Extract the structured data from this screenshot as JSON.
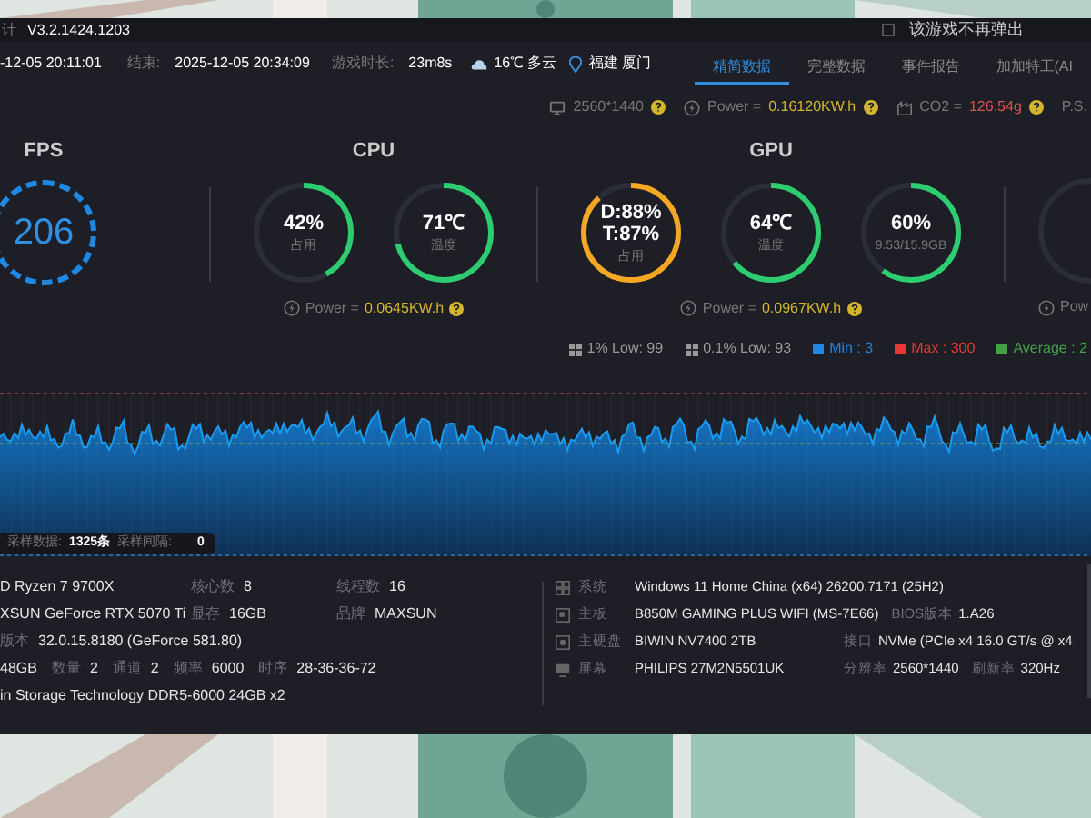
{
  "title_bar": {
    "app_name": "计",
    "version": "V3.2.1424.1203",
    "dont_show_again": {
      "label": "该游戏不再弹出",
      "checked": false
    }
  },
  "session": {
    "start": "-12-05 20:11:01",
    "end_label": "结束:",
    "end": "2025-12-05 20:34:09",
    "duration_label": "游戏时长:",
    "duration": "23m8s",
    "weather": "16℃ 多云",
    "location": "福建 厦门"
  },
  "tabs": [
    {
      "label": "精简数据",
      "selected": true
    },
    {
      "label": "完整数据",
      "selected": false
    },
    {
      "label": "事件报告",
      "selected": false
    },
    {
      "label": "加加特工(AI",
      "selected": false
    }
  ],
  "summary": [
    {
      "kind": "resolution",
      "value": "2560*1440"
    },
    {
      "kind": "power",
      "label": "Power = ",
      "value": "0.16120KW.h"
    },
    {
      "kind": "co2",
      "label": "CO2 = ",
      "value": "126.54g"
    },
    {
      "kind": "note",
      "value": "P.S."
    }
  ],
  "fps": {
    "title": "FPS",
    "value": "206"
  },
  "cpu": {
    "title": "CPU",
    "gauges": [
      {
        "values": [
          "42%"
        ],
        "caption": "占用",
        "level": 0.42,
        "color": "#2ecc71"
      },
      {
        "values": [
          "71℃"
        ],
        "caption": "温度",
        "level": 0.71,
        "color": "#2ecc71"
      }
    ],
    "power_label": "Power = ",
    "power": "0.0645KW.h"
  },
  "gpu": {
    "title": "GPU",
    "gauges": [
      {
        "values": [
          "D:88%",
          "T:87%"
        ],
        "caption": "占用",
        "level": 0.88,
        "color": "#f5a623"
      },
      {
        "values": [
          "64℃"
        ],
        "caption": "温度",
        "level": 0.64,
        "color": "#2ecc71"
      },
      {
        "values": [
          "60%"
        ],
        "caption": "9.53/15.9GB",
        "level": 0.6,
        "color": "#2ecc71"
      }
    ],
    "power_label": "Power = ",
    "power": "0.0967KW.h"
  },
  "next_panel": {
    "power_label": "Pow"
  },
  "fps_stats": [
    {
      "kind": "low",
      "text": "1% Low: 99"
    },
    {
      "kind": "low",
      "text": "0.1% Low: 93"
    },
    {
      "kind": "legend",
      "text": "Min : 3",
      "color": "#1e88e5"
    },
    {
      "kind": "legend",
      "text": "Max : 300",
      "color": "#e53935"
    },
    {
      "kind": "legend",
      "text": "Average : 2",
      "color": "#43a047"
    }
  ],
  "chart_footer": {
    "samples_label": "采样数据:",
    "samples": "1325条",
    "interval_label": "采样间隔:",
    "interval": "0"
  },
  "hardware_left": [
    [
      {
        "value": "D Ryzen 7 9700X"
      },
      {
        "label": "核心数",
        "value": "8"
      },
      {
        "label": "线程数",
        "value": "16"
      }
    ],
    [
      {
        "value": "XSUN GeForce RTX 5070 Ti"
      },
      {
        "label": "显存",
        "value": "16GB"
      },
      {
        "label": "品牌",
        "value": "MAXSUN"
      }
    ],
    [
      {
        "label": "版本",
        "value": "32.0.15.8180 (GeForce 581.80)"
      }
    ],
    [
      {
        "value": "48GB"
      },
      {
        "label": "数量",
        "value": "2"
      },
      {
        "label": "通道",
        "value": "2"
      },
      {
        "label": "频率",
        "value": "6000"
      },
      {
        "label": "时序",
        "value": "28-36-36-72"
      }
    ],
    [
      {
        "value": "in Storage Technology DDR5-6000 24GB x2"
      }
    ]
  ],
  "hardware_right": [
    {
      "kind": "system",
      "label": "系统",
      "value": "Windows 11 Home China (x64) 26200.7171 (25H2)"
    },
    {
      "kind": "motherboard",
      "label": "主板",
      "value": "B850M GAMING PLUS WIFI (MS-7E66)",
      "extras": [
        {
          "label": "BIOS版本",
          "value": "1.A26"
        }
      ]
    },
    {
      "kind": "disk",
      "label": "主硬盘",
      "value": "BIWIN NV7400 2TB",
      "extras": [
        {
          "label": "接口",
          "value": "NVMe (PCIe x4 16.0 GT/s @ x4"
        }
      ]
    },
    {
      "kind": "monitor",
      "label": "屏幕",
      "value": "PHILIPS 27M2N5501UK",
      "extras": [
        {
          "label": "分辨率",
          "value": "2560*1440"
        },
        {
          "label": "刷新率",
          "value": "320Hz"
        }
      ]
    }
  ]
}
